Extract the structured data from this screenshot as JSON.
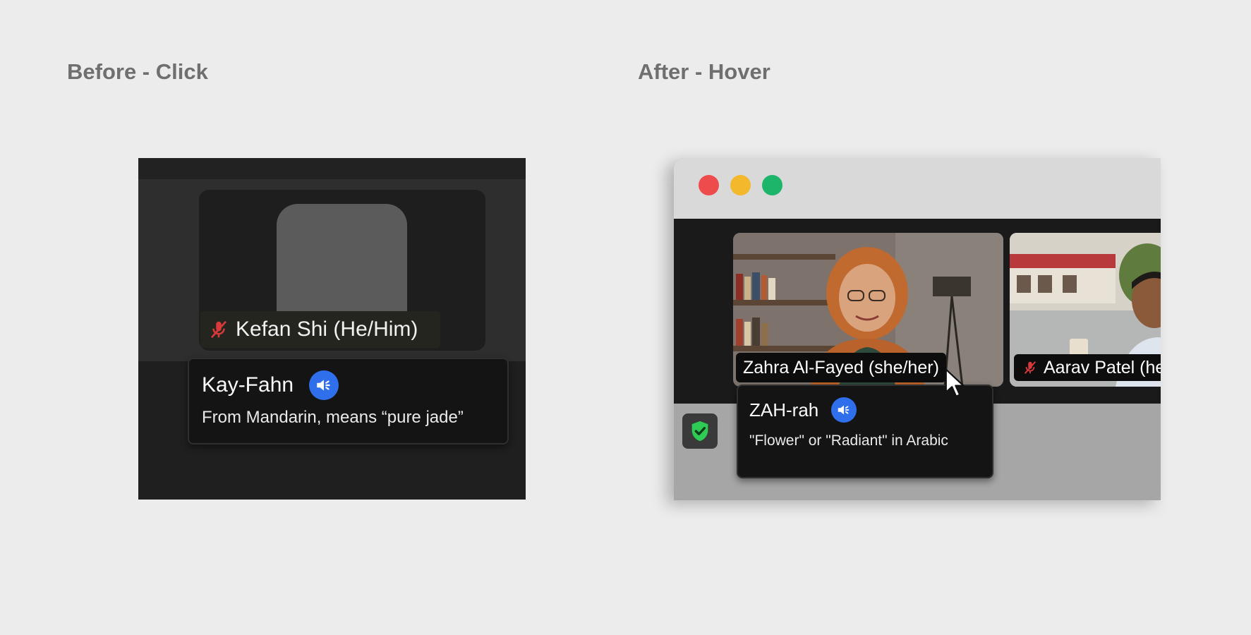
{
  "labels": {
    "before": "Before - Click",
    "after": "After - Hover"
  },
  "before": {
    "participant_name": "Kefan Shi (He/Him)",
    "mic_state": "muted",
    "tooltip": {
      "phonetic": "Kay-Fahn",
      "meaning": "From Mandarin, means “pure jade”",
      "speaker_icon": "speaker-icon"
    }
  },
  "after": {
    "window_controls": [
      "close",
      "minimize",
      "maximize"
    ],
    "participants": [
      {
        "name": "Zahra Al-Fayed (she/her)",
        "mic_state": "on"
      },
      {
        "name": "Aarav Patel (he",
        "mic_state": "muted"
      }
    ],
    "tooltip": {
      "phonetic": "ZAH-rah",
      "meaning": "\"Flower\" or \"Radiant\" in Arabic",
      "speaker_icon": "speaker-icon"
    },
    "security_icon": "shield-check-icon"
  },
  "colors": {
    "accent": "#2f6fec",
    "muted_mic": "#d9393a",
    "shield": "#2ecc55",
    "traffic_close": "#ee4c4c",
    "traffic_minimize": "#f4b82d",
    "traffic_maximize": "#1db56a"
  }
}
